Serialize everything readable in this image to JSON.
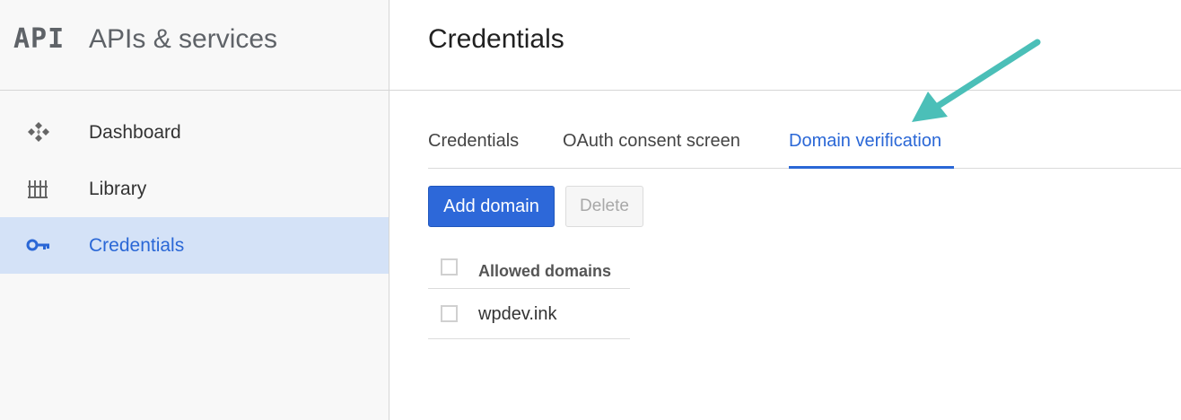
{
  "sidebar": {
    "logo_text": "API",
    "product_title": "APIs & services",
    "items": [
      {
        "label": "Dashboard",
        "icon": "dashboard-icon",
        "active": false
      },
      {
        "label": "Library",
        "icon": "library-icon",
        "active": false
      },
      {
        "label": "Credentials",
        "icon": "key-icon",
        "active": true
      }
    ]
  },
  "main": {
    "page_title": "Credentials",
    "tabs": [
      {
        "label": "Credentials",
        "active": false
      },
      {
        "label": "OAuth consent screen",
        "active": false
      },
      {
        "label": "Domain verification",
        "active": true
      }
    ],
    "toolbar": {
      "add_label": "Add domain",
      "delete_label": "Delete"
    },
    "table": {
      "header": "Allowed domains",
      "rows": [
        {
          "domain": "wpdev.ink"
        }
      ]
    }
  },
  "colors": {
    "accent": "#2a67d6",
    "active_nav_bg": "#d4e2f7",
    "annotation_arrow": "#4bbfb8"
  },
  "icons": {
    "annotation": "arrow-icon"
  }
}
